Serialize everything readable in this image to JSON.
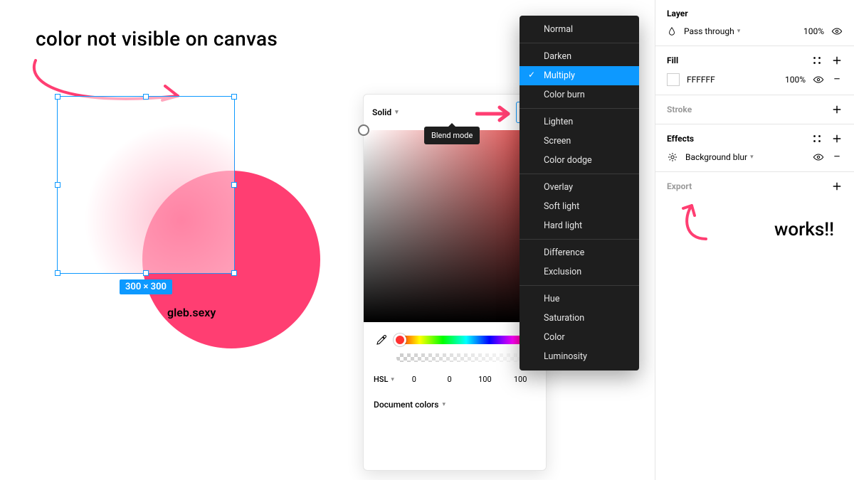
{
  "annotations": {
    "top": "color not visible on canvas",
    "right": "works!!"
  },
  "canvas": {
    "selection_size": "300 × 300",
    "credit": "gleb.sexy",
    "accent": "#ff3e72",
    "selection_border": "#0d99ff"
  },
  "color_picker": {
    "fill_type_label": "Solid",
    "blend_tooltip": "Blend mode",
    "model_label": "HSL",
    "h": "0",
    "s": "0",
    "l": "100",
    "a": "100",
    "doc_colors_label": "Document colors"
  },
  "blend_menu": {
    "groups": [
      [
        "Normal"
      ],
      [
        "Darken",
        "Multiply",
        "Color burn"
      ],
      [
        "Lighten",
        "Screen",
        "Color dodge"
      ],
      [
        "Overlay",
        "Soft light",
        "Hard light"
      ],
      [
        "Difference",
        "Exclusion"
      ],
      [
        "Hue",
        "Saturation",
        "Color",
        "Luminosity"
      ]
    ],
    "selected": "Multiply"
  },
  "inspector": {
    "layer": {
      "title": "Layer",
      "mode": "Pass through",
      "opacity": "100%"
    },
    "fill": {
      "title": "Fill",
      "hex": "FFFFFF",
      "opacity": "100%"
    },
    "stroke": {
      "title": "Stroke"
    },
    "effects": {
      "title": "Effects",
      "item": "Background blur"
    },
    "export": {
      "title": "Export"
    }
  }
}
